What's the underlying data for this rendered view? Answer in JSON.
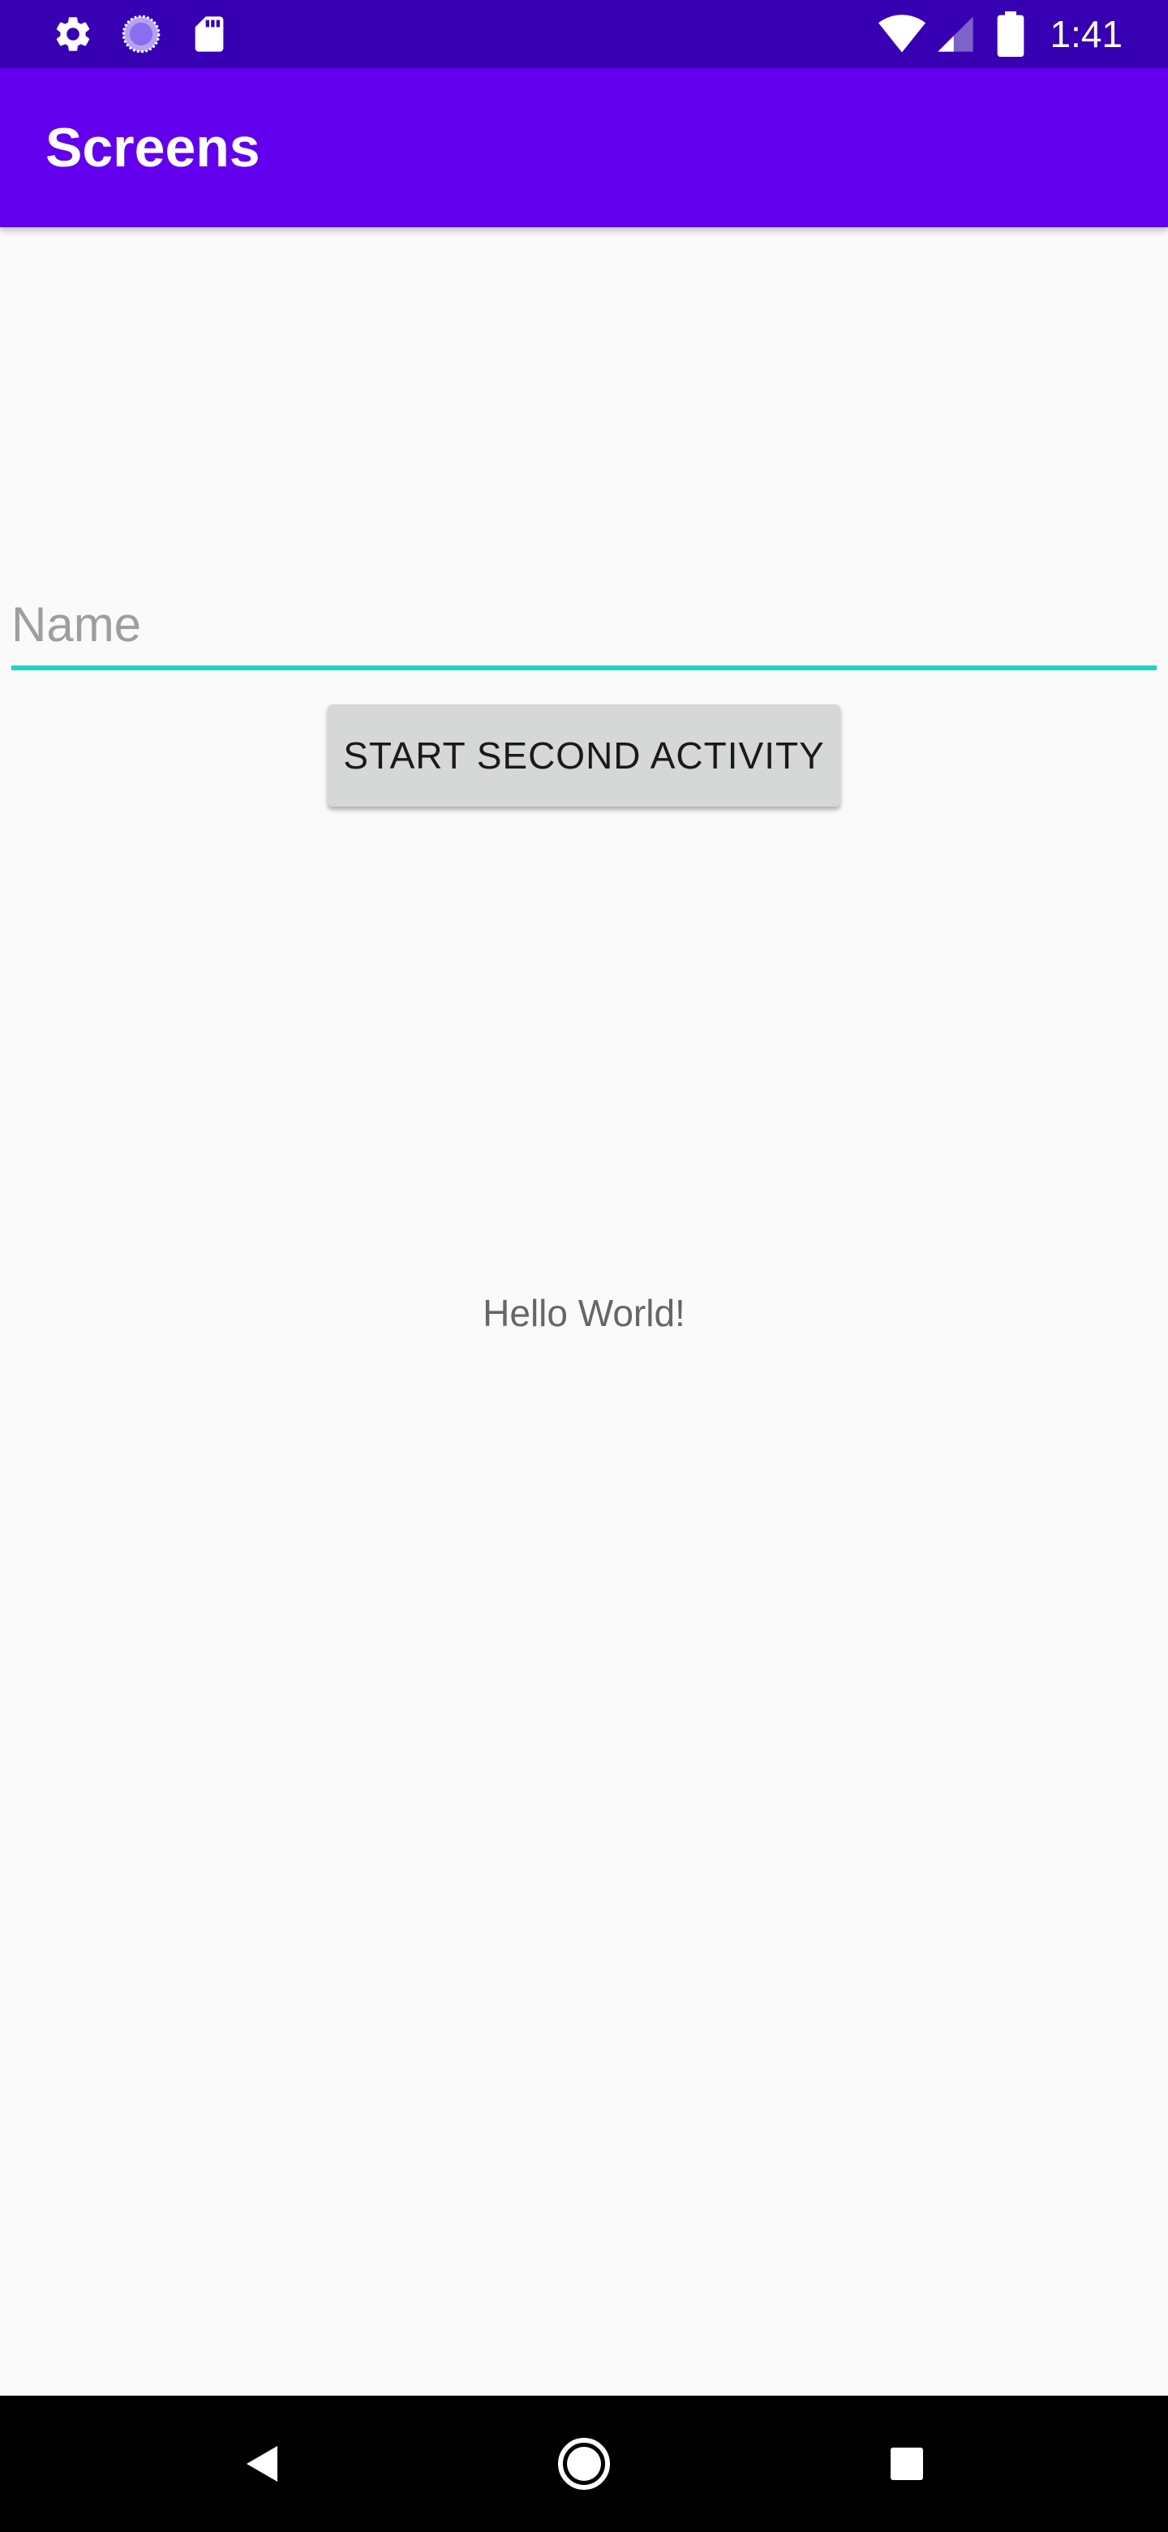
{
  "status_bar": {
    "time": "1:41",
    "icons_left": [
      "settings-icon",
      "loading-icon",
      "sd-card-icon"
    ],
    "icons_right": [
      "wifi-icon",
      "signal-icon",
      "battery-icon"
    ],
    "background": "#3700b3"
  },
  "app_bar": {
    "title": "Screens",
    "background": "#6200ee"
  },
  "form": {
    "name_placeholder": "Name",
    "name_value": "",
    "underline_color": "#1ed3c2",
    "start_button_label": "START SECOND ACTIVITY"
  },
  "main": {
    "hello_text": "Hello World!"
  },
  "nav_bar": {
    "buttons": [
      "back-icon",
      "home-icon",
      "recents-icon"
    ]
  }
}
